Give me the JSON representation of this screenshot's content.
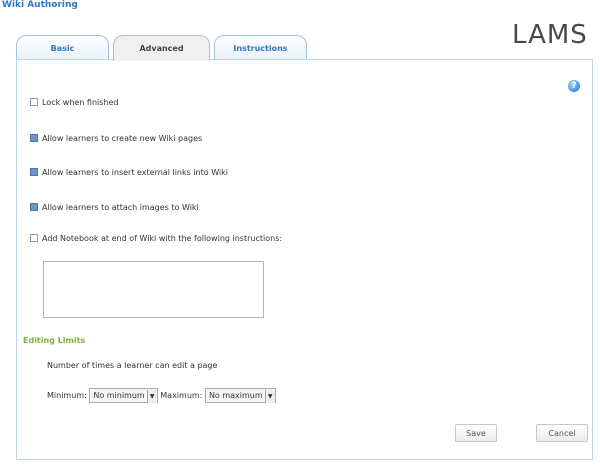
{
  "app": {
    "title": "Wiki Authoring",
    "logo": "LAMS"
  },
  "tabs": [
    {
      "label": "Basic",
      "active": false
    },
    {
      "label": "Advanced",
      "active": true
    },
    {
      "label": "Instructions",
      "active": false
    }
  ],
  "help_icon": {
    "icon": "help-icon"
  },
  "options": [
    {
      "label": "Lock when finished",
      "checked": false
    },
    {
      "label": "Allow learners to create new Wiki pages",
      "checked": true
    },
    {
      "label": "Allow learners to insert external links into Wiki",
      "checked": true
    },
    {
      "label": "Allow learners to attach images to Wiki",
      "checked": true
    },
    {
      "label": "Add Notebook at end of Wiki with the following instructions:",
      "checked": false
    }
  ],
  "notebook_instructions": {
    "value": ""
  },
  "editing_limits": {
    "title": "Editing Limits",
    "description": "Number of times a learner can edit a page",
    "minimum_label": "Minimum:",
    "minimum_value": "No minimum",
    "maximum_label": "Maximum:",
    "maximum_value": "No maximum"
  },
  "buttons": {
    "save": "Save",
    "cancel": "Cancel"
  },
  "colors": {
    "accent": "#2f77c2",
    "section": "#7fb23a",
    "border": "#bdd6ef"
  }
}
